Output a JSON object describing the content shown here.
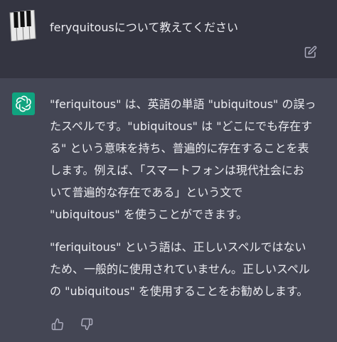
{
  "user_message": {
    "text": "feryquitousについて教えてください",
    "avatar_icon": "piano-keys-icon",
    "edit_icon": "edit-icon"
  },
  "assistant_message": {
    "logo_icon": "openai-logo-icon",
    "paragraph1_lines": [
      "\"feriquitous\" は、英語の単語 \"ubiquitous\" の誤っ",
      "たスペルです。\"ubiquitous\" は \"どこにでも存在す",
      "る\" という意味を持ち、普遍的に存在することを表",
      "します。例えば、「スマートフォンは現代社会にお",
      "いて普遍的な存在である」という文で",
      "\"ubiquitous\" を使うことができます。"
    ],
    "paragraph2_lines": [
      "\"feriquitous\" という語は、正しいスペルではない",
      "ため、一般的に使用されていません。正しいスペル",
      "の \"ubiquitous\" を使用することをお勧めします。"
    ],
    "thumbs_up_icon": "thumbs-up-icon",
    "thumbs_down_icon": "thumbs-down-icon"
  },
  "colors": {
    "user_bg": "#343541",
    "assistant_bg": "#444654",
    "logo_green": "#10a37f",
    "text": "#ececf1",
    "icon_gray": "#acacbe"
  }
}
